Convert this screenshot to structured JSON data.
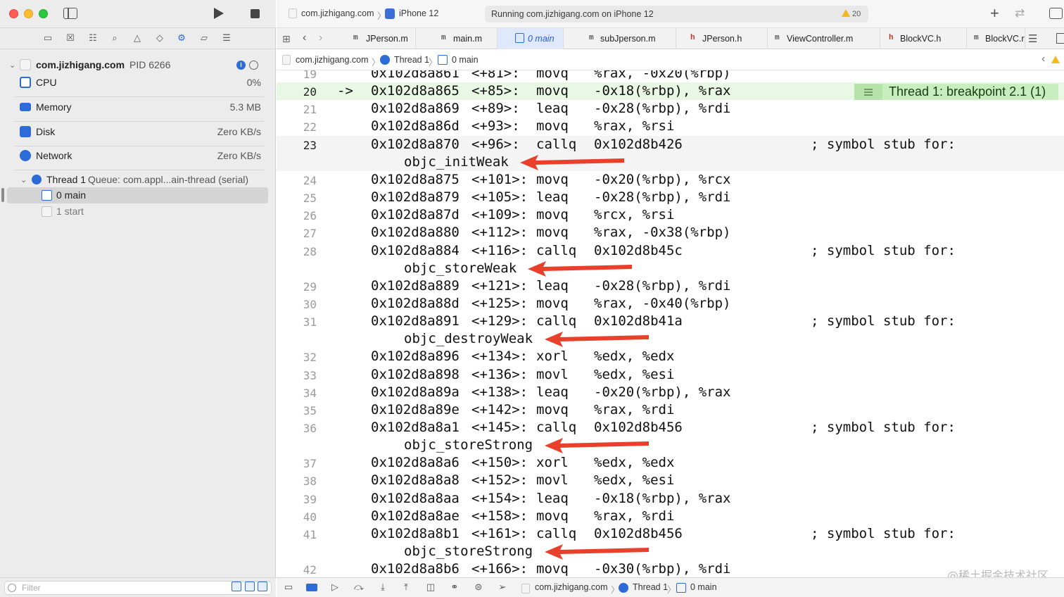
{
  "window": {
    "scheme": "com.jizhigang.com",
    "device": "iPhone 12",
    "status": "Running com.jizhigang.com on iPhone 12",
    "warnings": "20"
  },
  "colors": {
    "accent": "#2c6bd8",
    "breakpoint_bg": "#c8eec0",
    "current_line_bg": "#e9f7e5",
    "annotation_arrow": "#e8402a"
  },
  "navigator": {
    "process_name": "com.jizhigang.com",
    "pid": "PID 6266",
    "gauges": [
      {
        "label": "CPU",
        "value": "0%",
        "icon": "cpu-icon"
      },
      {
        "label": "Memory",
        "value": "5.3 MB",
        "icon": "memory-icon"
      },
      {
        "label": "Disk",
        "value": "Zero KB/s",
        "icon": "disk-icon"
      },
      {
        "label": "Network",
        "value": "Zero KB/s",
        "icon": "network-icon"
      }
    ],
    "thread_label": "Thread 1",
    "thread_queue": "Queue: com.appl...ain-thread (serial)",
    "frames": [
      {
        "label": "0 main"
      },
      {
        "label": "1 start"
      }
    ],
    "filter_placeholder": "Filter"
  },
  "tabs": [
    {
      "kind": "m",
      "label": "JPerson.m"
    },
    {
      "kind": "m",
      "label": "main.m"
    },
    {
      "kind": "thread",
      "label": "0 main"
    },
    {
      "kind": "m",
      "label": "subJperson.m"
    },
    {
      "kind": "h",
      "label": "JPerson.h"
    },
    {
      "kind": "m",
      "label": "ViewController.m"
    },
    {
      "kind": "h",
      "label": "BlockVC.h"
    },
    {
      "kind": "m",
      "label": "BlockVC.r"
    }
  ],
  "jumpbar": {
    "scheme": "com.jizhigang.com",
    "thread": "Thread 1",
    "frame": "0 main"
  },
  "editor": {
    "ip_marker": "->",
    "breakpoint_label": "Thread 1: breakpoint 2.1 (1)",
    "comment": "; symbol stub for:",
    "lines": [
      {
        "n": "19",
        "addr": "0x102d8a861",
        "off": "<+81>:",
        "op": "movq",
        "args": "%rax, -0x20(%rbp)"
      },
      {
        "n": "20",
        "addr": "0x102d8a865",
        "off": "<+85>:",
        "op": "movq",
        "args": "-0x18(%rbp), %rax"
      },
      {
        "n": "21",
        "addr": "0x102d8a869",
        "off": "<+89>:",
        "op": "leaq",
        "args": "-0x28(%rbp), %rdi"
      },
      {
        "n": "22",
        "addr": "0x102d8a86d",
        "off": "<+93>:",
        "op": "movq",
        "args": "%rax, %rsi"
      },
      {
        "n": "23",
        "addr": "0x102d8a870",
        "off": "<+96>:",
        "op": "callq",
        "args": "0x102d8b426",
        "sym": "objc_initWeak"
      },
      {
        "n": "24",
        "addr": "0x102d8a875",
        "off": "<+101>:",
        "op": "movq",
        "args": "-0x20(%rbp), %rcx"
      },
      {
        "n": "25",
        "addr": "0x102d8a879",
        "off": "<+105>:",
        "op": "leaq",
        "args": "-0x28(%rbp), %rdi"
      },
      {
        "n": "26",
        "addr": "0x102d8a87d",
        "off": "<+109>:",
        "op": "movq",
        "args": "%rcx, %rsi"
      },
      {
        "n": "27",
        "addr": "0x102d8a880",
        "off": "<+112>:",
        "op": "movq",
        "args": "%rax, -0x38(%rbp)"
      },
      {
        "n": "28",
        "addr": "0x102d8a884",
        "off": "<+116>:",
        "op": "callq",
        "args": "0x102d8b45c",
        "sym": "objc_storeWeak"
      },
      {
        "n": "29",
        "addr": "0x102d8a889",
        "off": "<+121>:",
        "op": "leaq",
        "args": "-0x28(%rbp), %rdi"
      },
      {
        "n": "30",
        "addr": "0x102d8a88d",
        "off": "<+125>:",
        "op": "movq",
        "args": "%rax, -0x40(%rbp)"
      },
      {
        "n": "31",
        "addr": "0x102d8a891",
        "off": "<+129>:",
        "op": "callq",
        "args": "0x102d8b41a",
        "sym": "objc_destroyWeak"
      },
      {
        "n": "32",
        "addr": "0x102d8a896",
        "off": "<+134>:",
        "op": "xorl",
        "args": "%edx, %edx"
      },
      {
        "n": "33",
        "addr": "0x102d8a898",
        "off": "<+136>:",
        "op": "movl",
        "args": "%edx, %esi"
      },
      {
        "n": "34",
        "addr": "0x102d8a89a",
        "off": "<+138>:",
        "op": "leaq",
        "args": "-0x20(%rbp), %rax"
      },
      {
        "n": "35",
        "addr": "0x102d8a89e",
        "off": "<+142>:",
        "op": "movq",
        "args": "%rax, %rdi"
      },
      {
        "n": "36",
        "addr": "0x102d8a8a1",
        "off": "<+145>:",
        "op": "callq",
        "args": "0x102d8b456",
        "sym": "objc_storeStrong"
      },
      {
        "n": "37",
        "addr": "0x102d8a8a6",
        "off": "<+150>:",
        "op": "xorl",
        "args": "%edx, %edx"
      },
      {
        "n": "38",
        "addr": "0x102d8a8a8",
        "off": "<+152>:",
        "op": "movl",
        "args": "%edx, %esi"
      },
      {
        "n": "39",
        "addr": "0x102d8a8aa",
        "off": "<+154>:",
        "op": "leaq",
        "args": "-0x18(%rbp), %rax"
      },
      {
        "n": "40",
        "addr": "0x102d8a8ae",
        "off": "<+158>:",
        "op": "movq",
        "args": "%rax, %rdi"
      },
      {
        "n": "41",
        "addr": "0x102d8a8b1",
        "off": "<+161>:",
        "op": "callq",
        "args": "0x102d8b456",
        "sym": "objc_storeStrong"
      },
      {
        "n": "42",
        "addr": "0x102d8a8b6",
        "off": "<+166>:",
        "op": "movq",
        "args": "-0x30(%rbp), %rdi"
      }
    ]
  },
  "debugbar": {
    "scheme": "com.jizhigang.com",
    "thread": "Thread 1",
    "frame": "0 main"
  },
  "watermark": "@稀土掘金技术社区"
}
